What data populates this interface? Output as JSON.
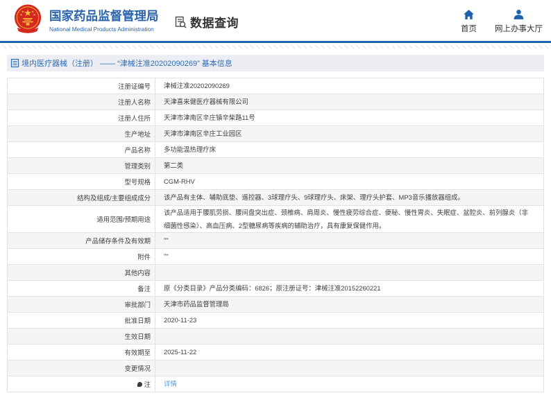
{
  "header": {
    "logo_title": "国家药品监督管理局",
    "logo_subtitle": "National Medical Products Administration",
    "section_label": "数据查询",
    "nav": [
      {
        "label": "首页",
        "icon": "home-icon"
      },
      {
        "label": "网上办事大厅",
        "icon": "user-icon"
      }
    ]
  },
  "breadcrumb": {
    "text": "境内医疗器械（注册） ——  “津械注准20202090269” 基本信息"
  },
  "colors": {
    "brand_blue": "#2a65ae",
    "link_blue": "#4698e8",
    "emblem_red": "#d5281e"
  },
  "table": {
    "rows": [
      {
        "label": "注册证编号",
        "value": "津械注准20202090269"
      },
      {
        "label": "注册人名称",
        "value": "天津喜来健医疗器械有限公司"
      },
      {
        "label": "注册人住所",
        "value": "天津市津南区辛庄镇辛柴路11号"
      },
      {
        "label": "生产地址",
        "value": "天津市津南区辛庄工业园区"
      },
      {
        "label": "产品名称",
        "value": "多功能温热理疗床"
      },
      {
        "label": "管理类别",
        "value": "第二类"
      },
      {
        "label": "型号规格",
        "value": "CGM-RHV"
      },
      {
        "label": "结构及组成/主要组成成分",
        "value": "该产品有主体、辅助底垫、遥控器、3球理疗头、9球理疗头、床架、理疗头护套、MP3音乐播放器组成。"
      },
      {
        "label": "适用范围/预期用途",
        "value": "该产品适用于腰肌劳损、腰间盘突出症、颈椎病、肩周炎、慢性疲劳综合症、便秘、慢性胃炎、失眠症、盆腔炎、前列腺炎（非细菌性感染）、高血压病、2型糖尿病等疾病的辅助治疗，具有康复保健作用。",
        "tall": true
      },
      {
        "label": "产品储存条件及有效期",
        "value": "\"\""
      },
      {
        "label": "附件",
        "value": "\"\""
      },
      {
        "label": "其他内容",
        "value": ""
      },
      {
        "label": "备注",
        "value": "原《分类目录》产品分类编码：6826；原注册证号：津械注准20152260221"
      },
      {
        "label": "审批部门",
        "value": "天津市药品监督管理局"
      },
      {
        "label": "批准日期",
        "value": "2020-11-23"
      },
      {
        "label": "生效日期",
        "value": ""
      },
      {
        "label": "有效期至",
        "value": "2025-11-22"
      },
      {
        "label": "变更情况",
        "value": ""
      },
      {
        "label": "注",
        "value": "详情",
        "link": true,
        "label_icon": "note-icon"
      }
    ]
  }
}
